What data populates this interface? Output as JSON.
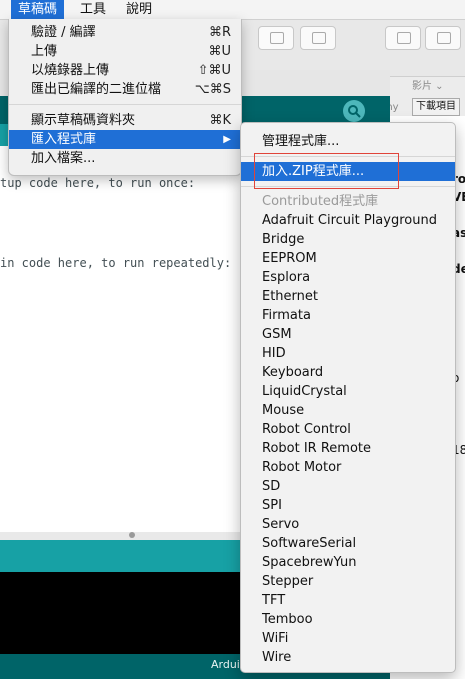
{
  "menubar": {
    "items": [
      {
        "label": "草稿碼",
        "active": true
      },
      {
        "label": "工具",
        "active": false
      },
      {
        "label": "說明",
        "active": false
      }
    ]
  },
  "sketch_menu": {
    "items": [
      {
        "label": "驗證 / 編譯",
        "shortcut": "⌘R"
      },
      {
        "label": "上傳",
        "shortcut": "⌘U"
      },
      {
        "label": "以燒錄器上傳",
        "shortcut": "⇧⌘U"
      },
      {
        "label": "匯出已編譯的二進位檔",
        "shortcut": "⌥⌘S"
      },
      {
        "label": "顯示草稿碼資料夾",
        "shortcut": "⌘K"
      },
      {
        "label": "匯入程式庫",
        "shortcut": "▶"
      },
      {
        "label": "加入檔案...",
        "shortcut": ""
      }
    ]
  },
  "library_submenu": {
    "manage": "管理程式庫...",
    "add_zip": "加入.ZIP程式庫...",
    "contributed_header": "Contributed程式庫",
    "libraries": [
      "Adafruit Circuit Playground",
      "Bridge",
      "EEPROM",
      "Esplora",
      "Ethernet",
      "Firmata",
      "GSM",
      "HID",
      "Keyboard",
      "LiquidCrystal",
      "Mouse",
      "Robot Control",
      "Robot IR Remote",
      "Robot Motor",
      "SD",
      "SPI",
      "Servo",
      "SoftwareSerial",
      "SpacebrewYun",
      "Stepper",
      "TFT",
      "Temboo",
      "WiFi",
      "Wire"
    ]
  },
  "editor": {
    "line1": "tup code here, to run once:",
    "line2": "in code here, to run repeatedly:"
  },
  "footer": {
    "text": "Arduin"
  },
  "background": {
    "tab_partial_1": "nny",
    "tab_partial_2": "下載項目",
    "tab_partial_3": "影片",
    "right_fragments": [
      "ro",
      "VE",
      "as",
      "de",
      "o",
      "18"
    ]
  }
}
